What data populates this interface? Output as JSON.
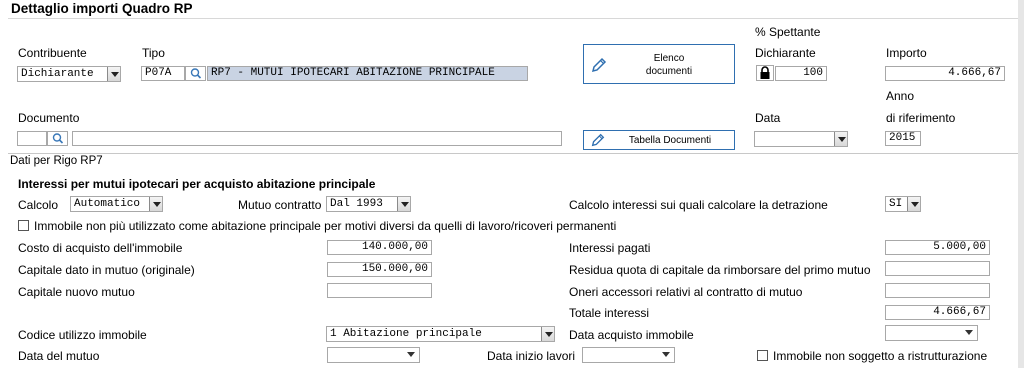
{
  "header": {
    "title": "Dettaglio importi Quadro RP"
  },
  "top": {
    "spettante_label": "% Spettante",
    "contribuente_label": "Contribuente",
    "contribuente_value": "Dichiarante",
    "tipo_label": "Tipo",
    "tipo_code": "P07A",
    "tipo_desc": "RP7 - MUTUI IPOTECARI ABITAZIONE PRINCIPALE",
    "elenco_btn_line1": "Elenco",
    "elenco_btn_line2": "documenti",
    "dichiarante_label": "Dichiarante",
    "dichiarante_value": "100",
    "importo_label": "Importo",
    "importo_value": "4.666,67",
    "anno_label": "Anno",
    "documento_label": "Documento",
    "documento_code": "",
    "documento_desc": "",
    "tabella_btn": "Tabella Documenti",
    "data_label": "Data",
    "data_value": "",
    "riferimento_label": "di riferimento",
    "riferimento_value": "2015"
  },
  "section": {
    "title": "Dati per Rigo RP7",
    "subtitle": "Interessi per mutui ipotecari per acquisto abitazione principale"
  },
  "form": {
    "calcolo_label": "Calcolo",
    "calcolo_value": "Automatico",
    "mutuo_contratto_label": "Mutuo contratto",
    "mutuo_contratto_value": "Dal 1993",
    "calcolo_interessi_label": "Calcolo interessi sui quali calcolare la detrazione",
    "calcolo_interessi_value": "SI",
    "immobile_non_utilizzato_label": "Immobile non più utilizzato come abitazione principale per motivi diversi da quelli di lavoro/ricoveri permanenti",
    "costo_label": "Costo di acquisto dell'immobile",
    "costo_value": "140.000,00",
    "capitale_dato_label": "Capitale dato in mutuo (originale)",
    "capitale_dato_value": "150.000,00",
    "capitale_nuovo_label": "Capitale nuovo mutuo",
    "capitale_nuovo_value": "",
    "interessi_pagati_label": "Interessi pagati",
    "interessi_pagati_value": "5.000,00",
    "residua_label": "Residua quota di capitale da rimborsare del primo mutuo",
    "residua_value": "",
    "oneri_label": "Oneri accessori relativi al contratto di mutuo",
    "oneri_value": "",
    "totale_label": "Totale interessi",
    "totale_value": "4.666,67",
    "codice_label": "Codice utilizzo immobile",
    "codice_value": "1 Abitazione principale",
    "data_acquisto_label": "Data acquisto immobile",
    "data_acquisto_value": "",
    "data_mutuo_label": "Data del mutuo",
    "data_mutuo_value": "",
    "data_inizio_label": "Data inizio lavori",
    "data_inizio_value": "",
    "non_soggetto_label": "Immobile non soggetto a ristrutturazione"
  }
}
